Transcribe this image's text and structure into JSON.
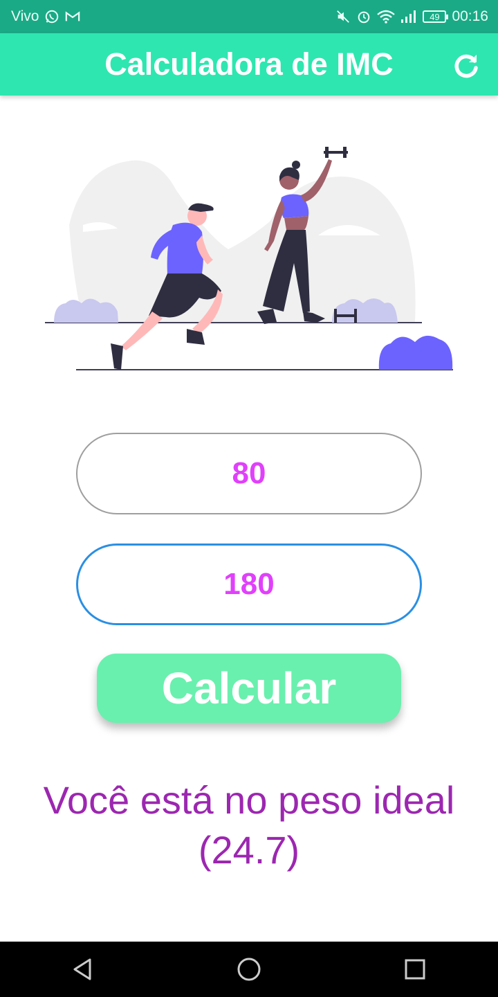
{
  "status_bar": {
    "carrier": "Vivo",
    "battery": "49",
    "time": "00:16"
  },
  "app_bar": {
    "title": "Calculadora de IMC",
    "refresh_icon": "refresh-icon"
  },
  "form": {
    "weight_value": "80",
    "height_value": "180",
    "calculate_label": "Calcular"
  },
  "result": {
    "message": "Você está no peso ideal",
    "value": "(24.7)"
  },
  "nav_bar": {
    "back_icon": "back-triangle-icon",
    "home_icon": "home-circle-icon",
    "recents_icon": "recents-square-icon"
  },
  "colors": {
    "status_bar": "#1aaa86",
    "app_bar": "#2ee6b0",
    "button": "#69f0ae",
    "input_text": "#e040fb",
    "result_text": "#9c27b0",
    "focused_border": "#2a8fe3"
  }
}
